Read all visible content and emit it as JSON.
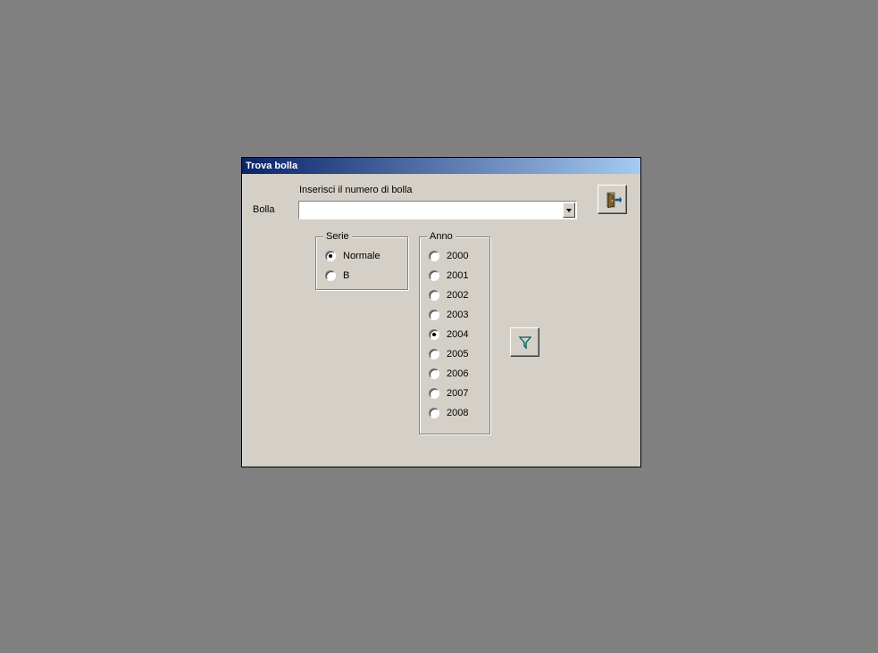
{
  "dialog": {
    "title": "Trova bolla",
    "instruction": "Inserisci il numero di bolla",
    "bolla_label": "Bolla",
    "bolla_value": ""
  },
  "serie": {
    "legend": "Serie",
    "options": [
      "Normale",
      "B"
    ],
    "selected": "Normale"
  },
  "anno": {
    "legend": "Anno",
    "options": [
      "2000",
      "2001",
      "2002",
      "2003",
      "2004",
      "2005",
      "2006",
      "2007",
      "2008"
    ],
    "selected": "2004"
  },
  "icons": {
    "close": "exit-door-icon",
    "filter": "funnel-filter-icon"
  }
}
